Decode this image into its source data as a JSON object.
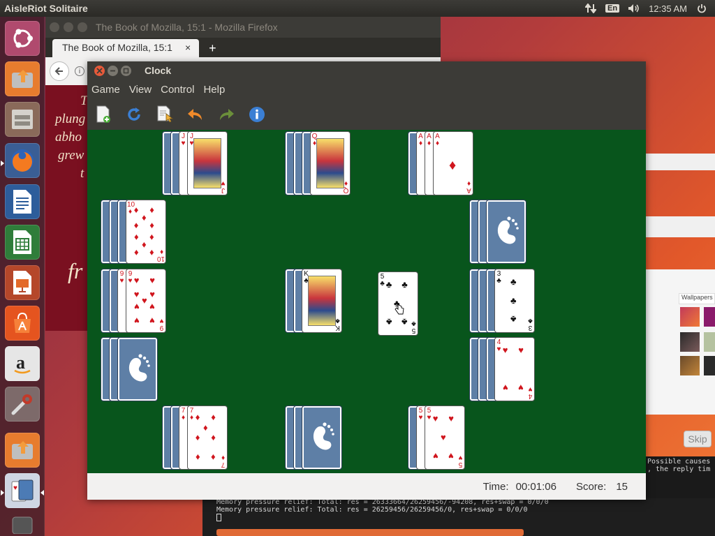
{
  "top_panel": {
    "app_title": "AisleRiot Solitaire",
    "keyboard_layout": "En",
    "clock": "12:35 AM",
    "icons": [
      "network-icon",
      "keyboard-layout-indicator",
      "volume-icon",
      "power-icon"
    ]
  },
  "launcher": {
    "items": [
      "ubuntu-dash-icon",
      "software-updater-icon",
      "files-icon",
      "firefox-icon",
      "libreoffice-writer-icon",
      "libreoffice-calc-icon",
      "libreoffice-impress-icon",
      "ubuntu-software-icon",
      "amazon-icon",
      "system-settings-icon",
      "software-updater-icon",
      "solitaire-icon",
      "trash-icon"
    ]
  },
  "firefox": {
    "window_title": "The Book of Mozilla, 15:1 - Mozilla Firefox",
    "tab_label": "The Book of Mozilla, 15:1",
    "tab_close": "×",
    "new_tab": "+",
    "page_lines": [
      "T",
      "plung",
      "abho",
      "grew",
      "t"
    ],
    "page_big": "fr"
  },
  "background_right": {
    "wallpapers_label": "Wallpapers",
    "skip_label": "Skip",
    "terminal_right_lines": [
      "Possible causes",
      ", the reply tim"
    ]
  },
  "terminal": {
    "lines": [
      "Memory pressure relief: Total: res = 26333664/26259456/-94208, res+swap = 0/0/0",
      "Memory pressure relief: Total: res = 26259456/26259456/0, res+swap = 0/0/0"
    ]
  },
  "solitaire": {
    "window_title": "Clock",
    "menus": [
      "Game",
      "View",
      "Control",
      "Help"
    ],
    "toolbar": [
      "new-game-icon",
      "restart-icon",
      "select-game-icon",
      "undo-icon",
      "redo-icon",
      "about-icon"
    ],
    "status": {
      "time_label": "Time:",
      "time_value": "00:01:06",
      "score_label": "Score:",
      "score_value": "15"
    },
    "colors": {
      "felt": "#08551c",
      "red_suit": "#d0161e",
      "card_back": "#5e7fa6"
    },
    "piles": [
      {
        "name": "pile-top-center-left",
        "backs": 2,
        "top": {
          "rank": "J",
          "suit": "♥",
          "color": "red",
          "face": true,
          "under": [
            "J"
          ]
        }
      },
      {
        "name": "pile-top-center",
        "backs": 3,
        "top": {
          "rank": "Q",
          "suit": "♦",
          "color": "red",
          "face": true,
          "under": []
        }
      },
      {
        "name": "pile-top-right",
        "backs": 1,
        "top": {
          "rank": "A",
          "suit": "♦",
          "color": "red",
          "face": false,
          "under": [
            "A",
            "A"
          ]
        }
      },
      {
        "name": "pile-row2-left",
        "backs": 3,
        "top": {
          "rank": "10",
          "suit": "♦",
          "color": "red",
          "face": false,
          "under": []
        }
      },
      {
        "name": "pile-row2-right",
        "backs": 3,
        "top": null
      },
      {
        "name": "pile-row3-left",
        "backs": 2,
        "top": {
          "rank": "9",
          "suit": "♥",
          "color": "red",
          "face": false,
          "under": [
            "9"
          ]
        }
      },
      {
        "name": "pile-center",
        "backs": 2,
        "top": {
          "rank": "K",
          "suit": "♣",
          "color": "black",
          "face": true,
          "under": []
        }
      },
      {
        "name": "pile-row3-right",
        "backs": 3,
        "top": {
          "rank": "3",
          "suit": "♣",
          "color": "black",
          "face": false,
          "under": []
        }
      },
      {
        "name": "pile-row4-left",
        "backs": 3,
        "top": null
      },
      {
        "name": "pile-row4-right",
        "backs": 3,
        "top": {
          "rank": "4",
          "suit": "♥",
          "color": "red",
          "face": false,
          "under": []
        }
      },
      {
        "name": "pile-bottom-center-left",
        "backs": 2,
        "top": {
          "rank": "7",
          "suit": "♦",
          "color": "red",
          "face": false,
          "under": [
            "7"
          ]
        }
      },
      {
        "name": "pile-bottom-center",
        "backs": 3,
        "top": null
      },
      {
        "name": "pile-bottom-right",
        "backs": 1,
        "top": {
          "rank": "5",
          "suit": "♥",
          "color": "red",
          "face": false,
          "under": [
            "5"
          ]
        }
      }
    ],
    "dragged_card": {
      "rank": "5",
      "suit": "♣",
      "color": "black"
    }
  }
}
